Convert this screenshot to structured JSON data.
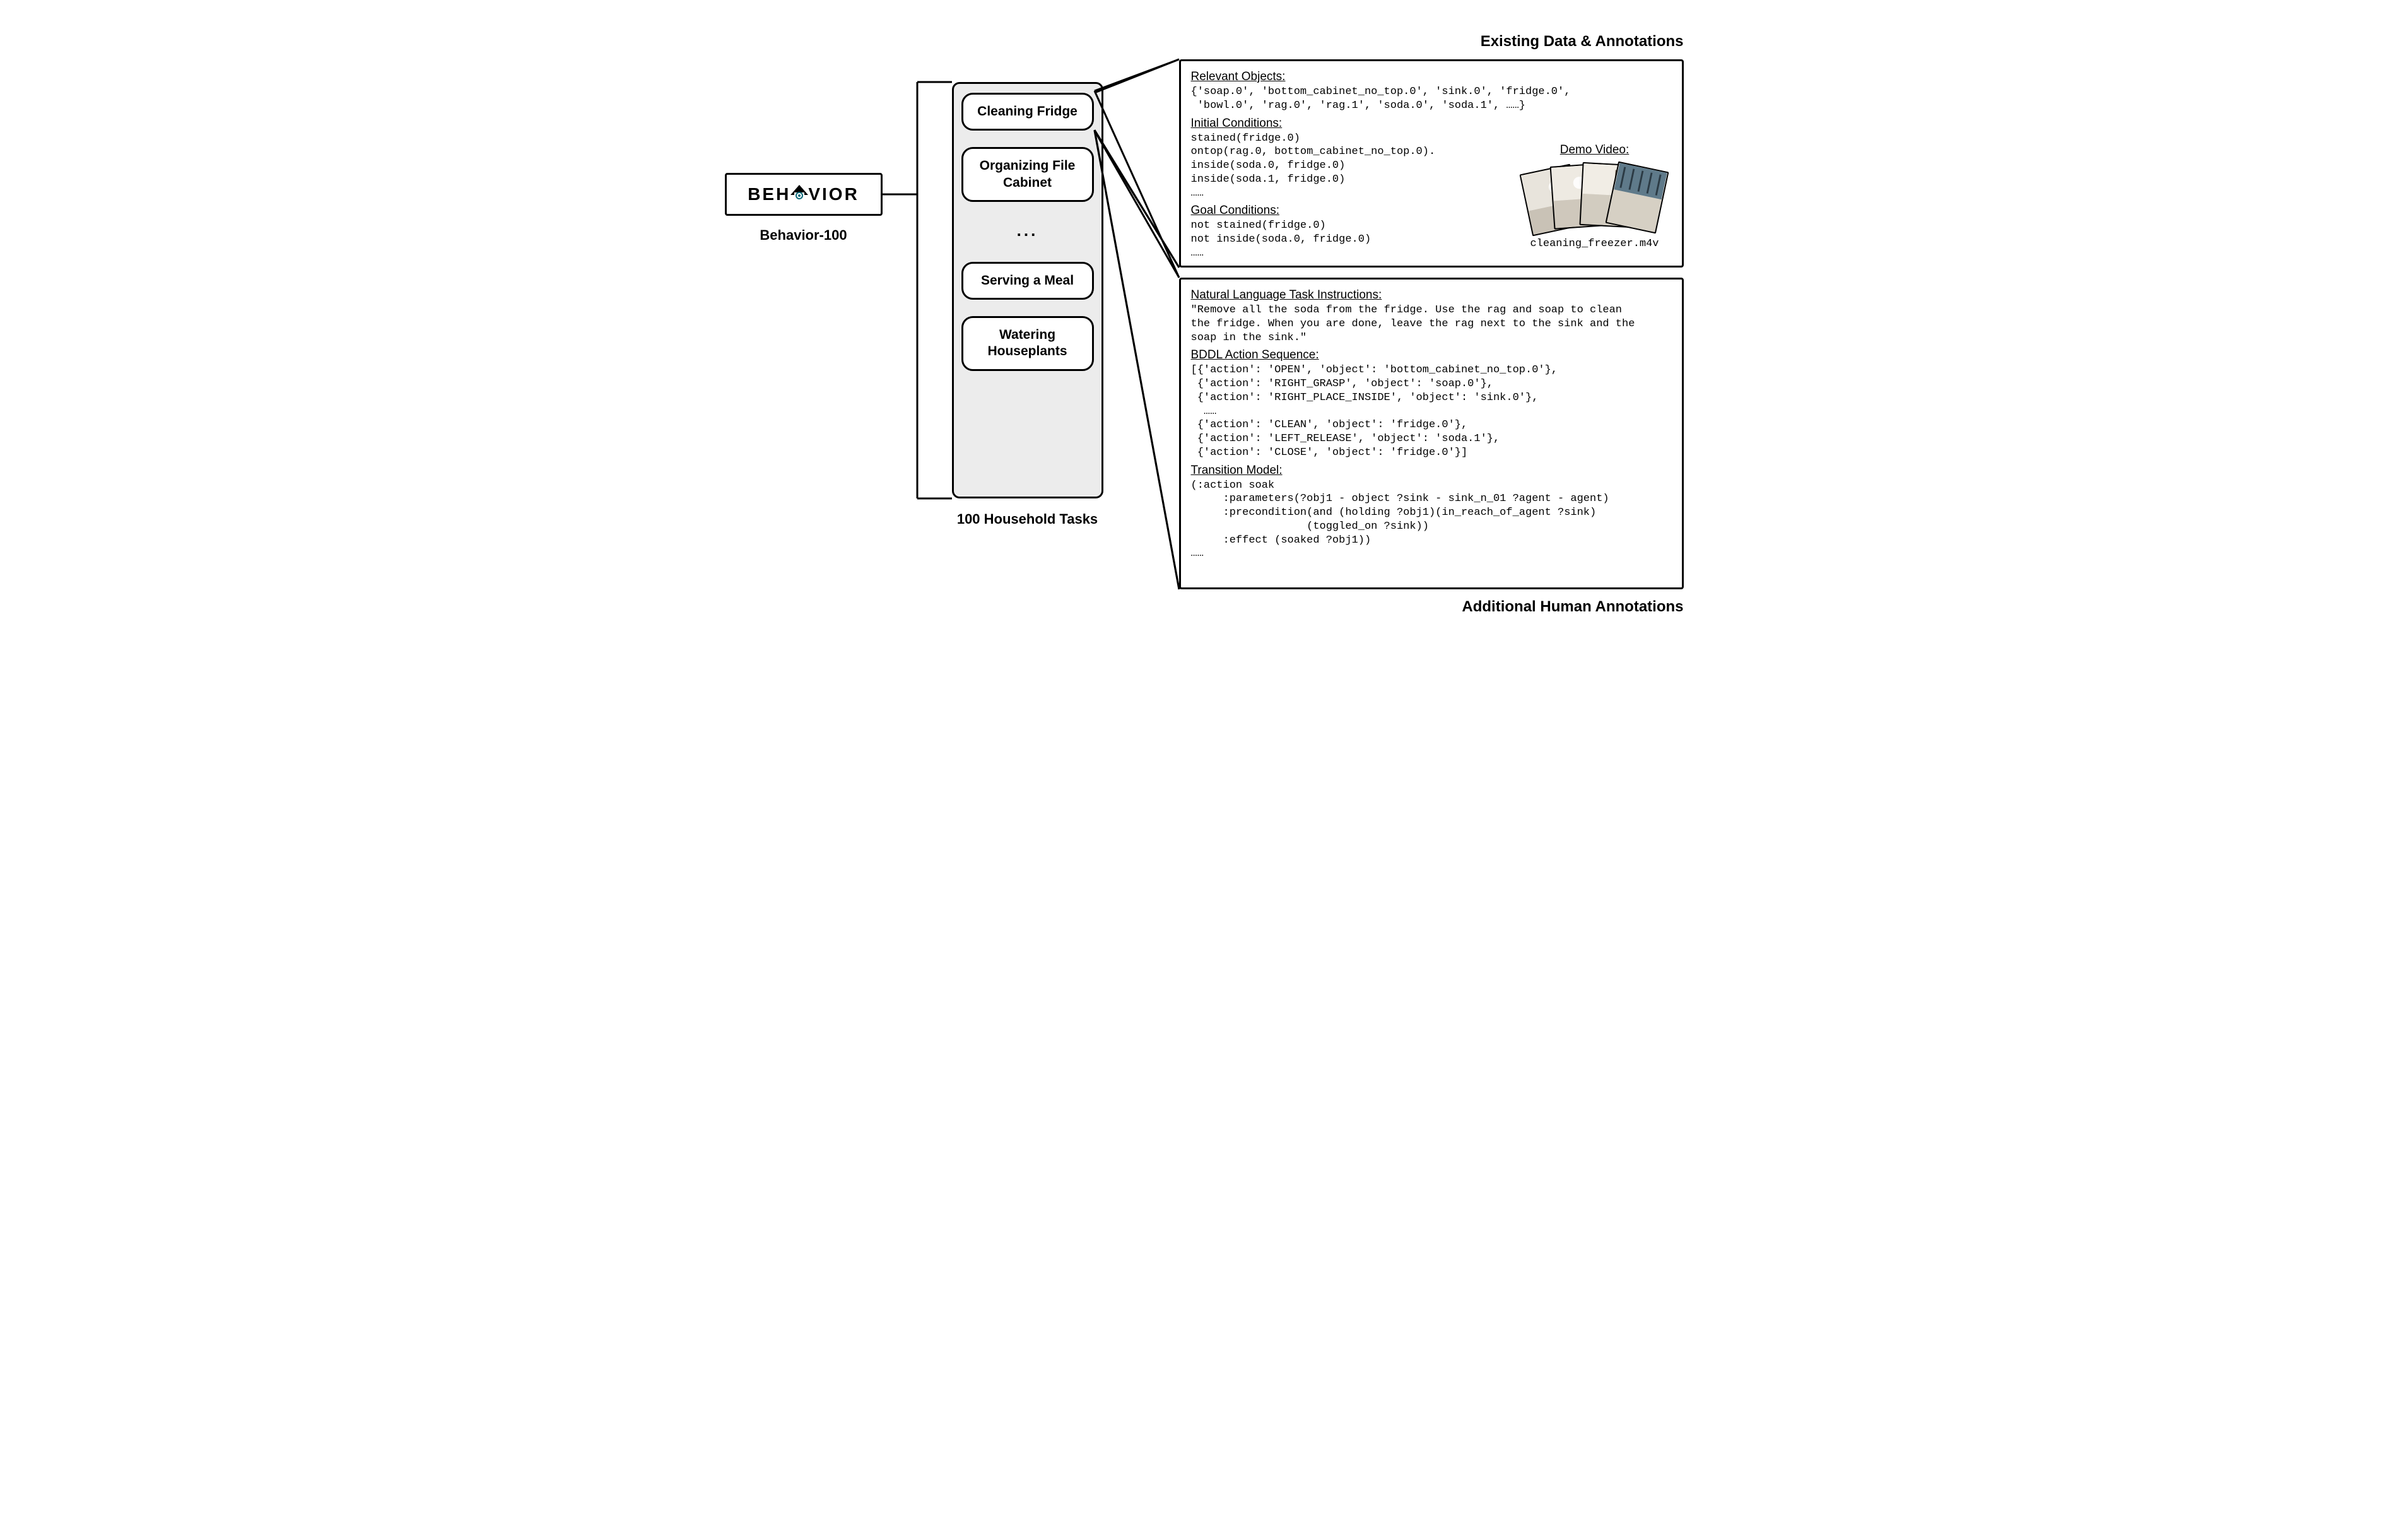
{
  "behavior": {
    "logo_pre": "BEH",
    "logo_post": "VIOR",
    "caption": "Behavior-100"
  },
  "tasks": {
    "items": [
      "Cleaning Fridge",
      "Organizing File Cabinet",
      "Serving a Meal",
      "Watering Houseplants"
    ],
    "ellipsis": "...",
    "caption": "100 Household Tasks"
  },
  "headers": {
    "top": "Existing Data & Annotations",
    "bottom": "Additional Human Annotations"
  },
  "existing": {
    "relevant_objects_title": "Relevant Objects:",
    "relevant_objects_text": "{'soap.0', 'bottom_cabinet_no_top.0', 'sink.0', 'fridge.0',\n 'bowl.0', 'rag.0', 'rag.1', 'soda.0', 'soda.1', ……}",
    "initial_conditions_title": "Initial Conditions:",
    "initial_conditions_text": "stained(fridge.0)\nontop(rag.0, bottom_cabinet_no_top.0).\ninside(soda.0, fridge.0)\ninside(soda.1, fridge.0)\n……",
    "goal_conditions_title": "Goal Conditions:",
    "goal_conditions_text": "not stained(fridge.0)\nnot inside(soda.0, fridge.0)\n……",
    "demo_title": "Demo Video:",
    "demo_filename": "cleaning_freezer.m4v"
  },
  "additional": {
    "nl_title": "Natural Language Task Instructions:",
    "nl_text": "\"Remove all the soda from the fridge. Use the rag and soap to clean\nthe fridge. When you are done, leave the rag next to the sink and the\nsoap in the sink.\"",
    "bddl_title": "BDDL Action Sequence:",
    "bddl_text": "[{'action': 'OPEN', 'object': 'bottom_cabinet_no_top.0'},\n {'action': 'RIGHT_GRASP', 'object': 'soap.0'},\n {'action': 'RIGHT_PLACE_INSIDE', 'object': 'sink.0'},\n  ……\n {'action': 'CLEAN', 'object': 'fridge.0'},\n {'action': 'LEFT_RELEASE', 'object': 'soda.1'},\n {'action': 'CLOSE', 'object': 'fridge.0'}]",
    "trans_title": "Transition Model:",
    "trans_text": "(:action soak\n     :parameters(?obj1 - object ?sink - sink_n_01 ?agent - agent)\n     :precondition(and (holding ?obj1)(in_reach_of_agent ?sink)\n                  (toggled_on ?sink))\n     :effect (soaked ?obj1))\n……"
  }
}
